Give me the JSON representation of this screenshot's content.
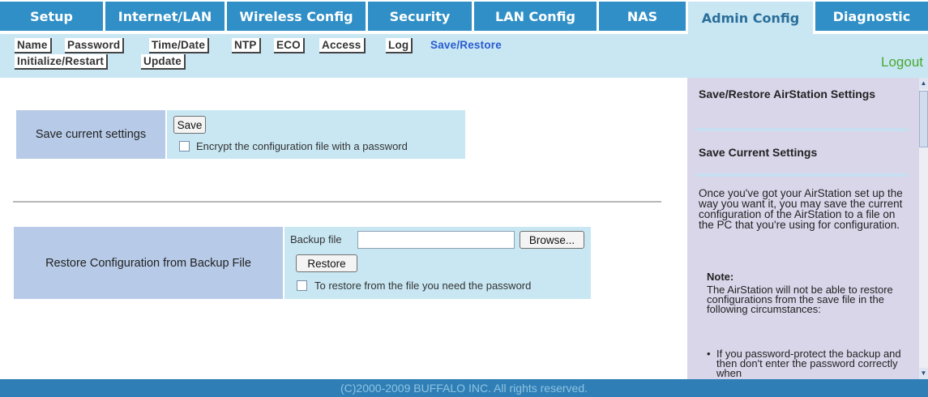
{
  "nav": {
    "tabs": [
      {
        "label": "Setup"
      },
      {
        "label": "Internet/LAN"
      },
      {
        "label": "Wireless Config"
      },
      {
        "label": "Security"
      },
      {
        "label": "LAN Config"
      },
      {
        "label": "NAS"
      },
      {
        "label": "Admin Config",
        "active": true
      },
      {
        "label": "Diagnostic"
      }
    ]
  },
  "subnav": {
    "items": [
      {
        "label": "Name"
      },
      {
        "label": "Password"
      },
      {
        "label": "Time/Date"
      },
      {
        "label": "NTP"
      },
      {
        "label": "ECO"
      },
      {
        "label": "Access"
      },
      {
        "label": "Log"
      },
      {
        "label": "Save/Restore",
        "active": true
      },
      {
        "label": "Initialize/Restart"
      },
      {
        "label": "Update"
      }
    ],
    "logout": "Logout"
  },
  "save_section": {
    "label": "Save current settings",
    "save_button": "Save",
    "encrypt_label": "Encrypt the configuration file with a password",
    "encrypt_checked": false
  },
  "restore_section": {
    "label": "Restore Configuration from Backup File",
    "backup_file_label": "Backup file",
    "backup_file_value": "",
    "browse_button": "Browse...",
    "restore_button": "Restore",
    "password_label": "To restore from the file you need the password",
    "password_checked": false
  },
  "help": {
    "title": "Save/Restore AirStation Settings",
    "subtitle": "Save Current Settings",
    "paragraph": "Once you've got your AirStation set up the way you want it, you may save the current configuration of the AirStation to a file on the PC that you're using for configuration.",
    "note_title": "Note:",
    "note_text": "The AirStation will not be able to restore configurations from the save file in the following circumstances:",
    "bullets": [
      "If you password-protect the backup and then don't enter the password correctly when"
    ]
  },
  "footer": "(C)2000-2009 BUFFALO INC. All rights reserved.",
  "colors": {
    "tab_blue": "#2f8fc6",
    "band": "#c8e7f3",
    "label_cell": "#b7cbe8",
    "help_bg": "#d9d6ea",
    "active_sub": "#2a5bd0",
    "logout": "#4aa830"
  }
}
